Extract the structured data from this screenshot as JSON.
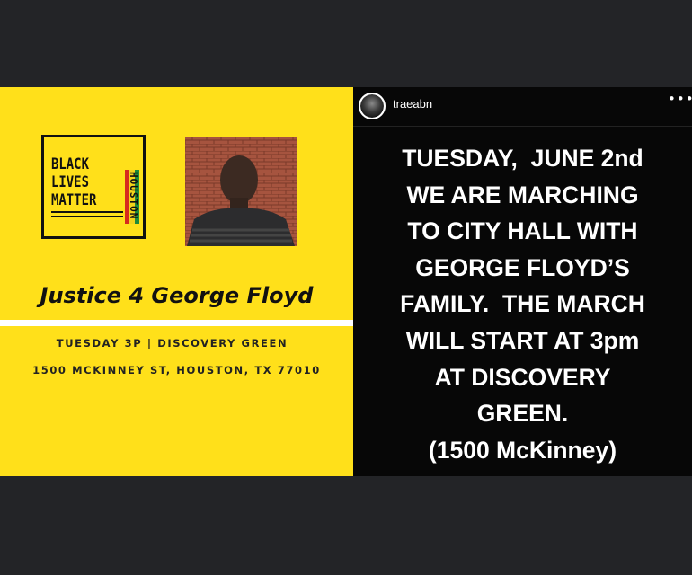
{
  "flyer": {
    "logo_lines": [
      "BLACK",
      "LIVES",
      "MATTER"
    ],
    "logo_side_text": "HOUSTON",
    "logo_stripe_colors": [
      "#d62a1e",
      "#f2d31b",
      "#1f8a3a"
    ],
    "photo_icon": "portrait-photo",
    "title": "Justice 4 George Floyd",
    "info_line_1": "TUESDAY 3P | DISCOVERY GREEN",
    "info_line_2": "1500 MCKINNEY ST, HOUSTON, TX 77010",
    "background_color": "#ffe01a"
  },
  "post": {
    "username": "traeabn",
    "more_icon": "more-horizontal-icon",
    "message_lines": [
      "TUESDAY,  JUNE 2nd",
      "WE ARE MARCHING",
      "TO CITY HALL WITH",
      "GEORGE FLOYD’S",
      "FAMILY.  THE MARCH",
      "WILL START AT 3pm",
      "AT DISCOVERY",
      "GREEN.",
      "(1500 McKinney)"
    ]
  }
}
